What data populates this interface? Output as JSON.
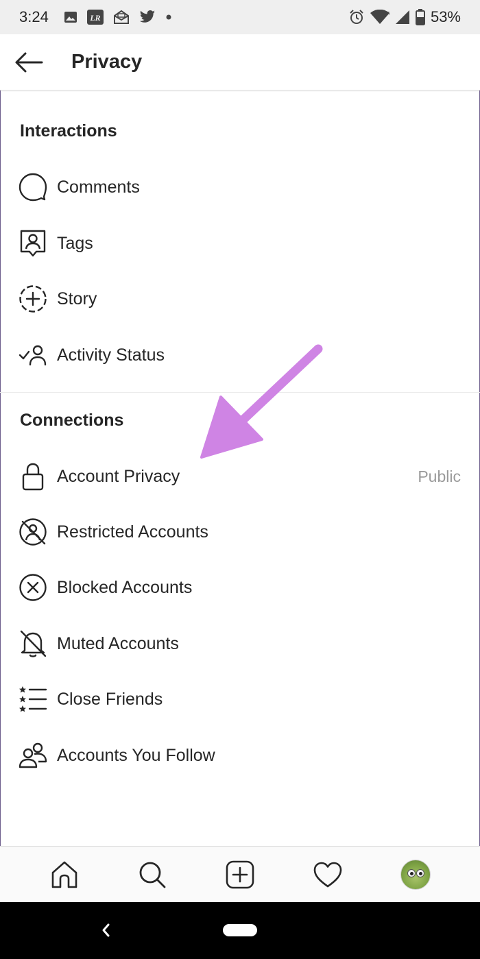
{
  "status_bar": {
    "time": "3:24",
    "battery": "53%",
    "left_icons": [
      "image-icon",
      "lr-icon",
      "mail-open-icon",
      "twitter-icon",
      "dot-icon"
    ],
    "right_icons": [
      "alarm-icon",
      "wifi-icon",
      "signal-icon",
      "battery-icon"
    ]
  },
  "header": {
    "title": "Privacy",
    "back_icon": "arrow-left-icon"
  },
  "sections": {
    "interactions": {
      "title": "Interactions",
      "items": [
        {
          "label": "Comments",
          "icon": "comment-bubble-icon"
        },
        {
          "label": "Tags",
          "icon": "tag-person-icon"
        },
        {
          "label": "Story",
          "icon": "story-add-icon"
        },
        {
          "label": "Activity Status",
          "icon": "activity-status-icon"
        }
      ]
    },
    "connections": {
      "title": "Connections",
      "items": [
        {
          "label": "Account Privacy",
          "value": "Public",
          "icon": "lock-icon"
        },
        {
          "label": "Restricted Accounts",
          "icon": "restricted-icon"
        },
        {
          "label": "Blocked Accounts",
          "icon": "blocked-icon"
        },
        {
          "label": "Muted Accounts",
          "icon": "bell-muted-icon"
        },
        {
          "label": "Close Friends",
          "icon": "star-list-icon"
        },
        {
          "label": "Accounts You Follow",
          "icon": "people-icon"
        }
      ]
    }
  },
  "bottom_nav": [
    "home-icon",
    "search-icon",
    "new-post-icon",
    "heart-icon",
    "profile-avatar"
  ],
  "colors": {
    "annotation_arrow": "#cf84e4",
    "text": "#262626",
    "secondary_text": "#9a9a9a"
  }
}
